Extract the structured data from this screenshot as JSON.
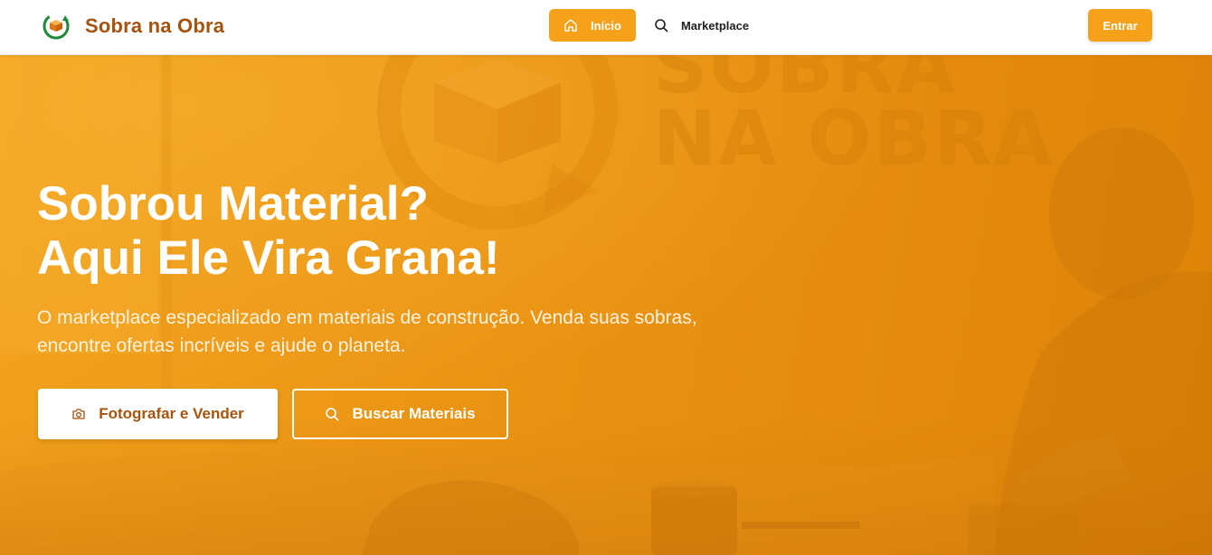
{
  "header": {
    "brand": "Sobra na Obra",
    "logo_icon": "recycle-box-icon",
    "nav": [
      {
        "label": "Início",
        "icon": "home-icon",
        "active": true
      },
      {
        "label": "Marketplace",
        "icon": "search-icon",
        "active": false
      }
    ],
    "login_label": "Entrar"
  },
  "hero": {
    "title_line1": "Sobrou Material?",
    "title_line2": "Aqui Ele Vira Grana!",
    "subtitle": "O marketplace especializado em materiais de construção. Venda suas sobras, encontre ofertas incríveis e ajude o planeta.",
    "primary_button": {
      "label": "Fotografar e Vender",
      "icon": "camera-icon"
    },
    "secondary_button": {
      "label": "Buscar Materiais",
      "icon": "search-icon"
    },
    "background_text": [
      "SOBRA",
      "NA OBRA"
    ]
  },
  "colors": {
    "brand": "#a4540e",
    "accent": "#f5a11a",
    "hero_orange": "#eb9414"
  }
}
